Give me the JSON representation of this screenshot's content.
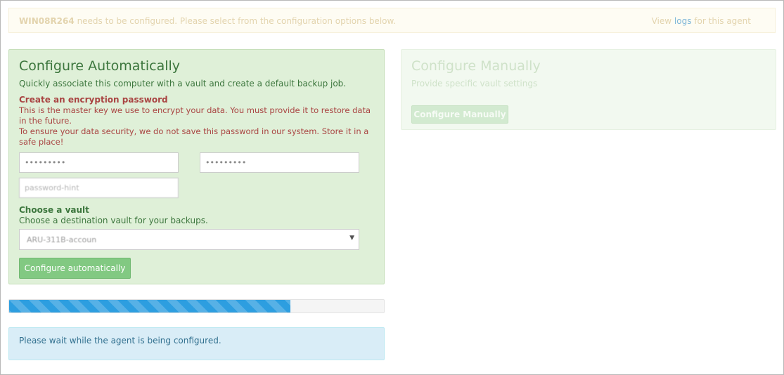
{
  "notice": {
    "agent_name": "WIN08R264",
    "message": "needs to be configured. Please select from the configuration options below.",
    "view_prefix": "View",
    "logs_link": "logs",
    "view_suffix": "for this agent"
  },
  "auto": {
    "title": "Configure Automatically",
    "description": "Quickly associate this computer with a vault and create a default backup job.",
    "encryption_title": "Create an encryption password",
    "encryption_text_1": "This is the master key we use to encrypt your data. You must provide it to restore data in the future.",
    "encryption_text_2": "To ensure your data security, we do not save this password in our system. Store it in a safe place!",
    "password_value": "•••••••••",
    "confirm_password_value": "•••••••••",
    "password_hint_value": "password-hint",
    "vault_title": "Choose a vault",
    "vault_desc": "Choose a destination vault for your backups.",
    "vault_selected": "ARU-311B-accoun",
    "button": "Configure automatically"
  },
  "manual": {
    "title": "Configure Manually",
    "description": "Provide specific vault settings",
    "button": "Configure Manually"
  },
  "progress": {
    "fraction": 0.75
  },
  "info": {
    "message": "Please wait while the agent is being configured."
  },
  "colors": {
    "success_bg": "#dff0d8",
    "danger_text": "#a94442",
    "progress_bar": "#2d9ee0",
    "info_bg": "#d9edf7"
  }
}
